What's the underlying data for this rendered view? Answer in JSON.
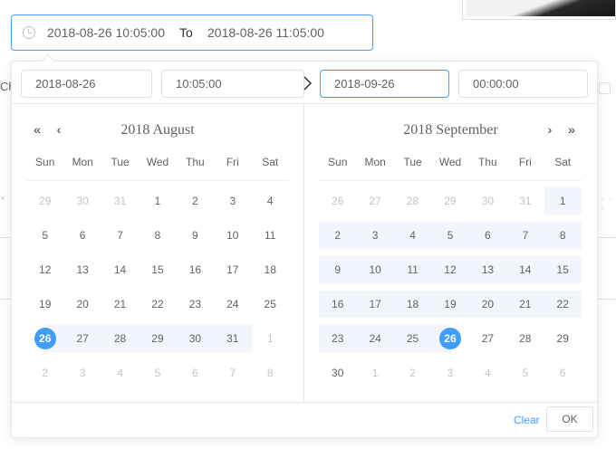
{
  "range": {
    "start": "2018-08-26 10:05:00",
    "separator": "To",
    "end": "2018-08-26 11:05:00"
  },
  "header": {
    "start_date": "2018-08-26",
    "start_time": "10:05:00",
    "end_date": "2018-09-26",
    "end_time": "00:00:00"
  },
  "background": {
    "partial_label": "Cha"
  },
  "left_calendar": {
    "title": "2018 August",
    "weekdays": [
      "Sun",
      "Mon",
      "Tue",
      "Wed",
      "Thu",
      "Fri",
      "Sat"
    ],
    "weeks": [
      [
        "29",
        "30",
        "31",
        "1",
        "2",
        "3",
        "4"
      ],
      [
        "5",
        "6",
        "7",
        "8",
        "9",
        "10",
        "11"
      ],
      [
        "12",
        "13",
        "14",
        "15",
        "16",
        "17",
        "18"
      ],
      [
        "19",
        "20",
        "21",
        "22",
        "23",
        "24",
        "25"
      ],
      [
        "26",
        "27",
        "28",
        "29",
        "30",
        "31",
        "1"
      ],
      [
        "2",
        "3",
        "4",
        "5",
        "6",
        "7",
        "8"
      ]
    ]
  },
  "right_calendar": {
    "title": "2018 September",
    "weekdays": [
      "Sun",
      "Mon",
      "Tue",
      "Wed",
      "Thu",
      "Fri",
      "Sat"
    ],
    "weeks": [
      [
        "26",
        "27",
        "28",
        "29",
        "30",
        "31",
        "1"
      ],
      [
        "2",
        "3",
        "4",
        "5",
        "6",
        "7",
        "8"
      ],
      [
        "9",
        "10",
        "11",
        "12",
        "13",
        "14",
        "15"
      ],
      [
        "16",
        "17",
        "18",
        "19",
        "20",
        "21",
        "22"
      ],
      [
        "23",
        "24",
        "25",
        "26",
        "27",
        "28",
        "29"
      ],
      [
        "30",
        "1",
        "2",
        "3",
        "4",
        "5",
        "6"
      ]
    ]
  },
  "footer": {
    "clear_label": "Clear",
    "ok_label": "OK"
  },
  "colors": {
    "accent": "#409eff",
    "range_background": "#f2f6fc"
  },
  "icons": {
    "range_icon": "clock-icon",
    "prev_year": "double-chevron-left-icon",
    "prev_month": "chevron-left-icon",
    "next_month": "chevron-right-icon",
    "next_year": "double-chevron-right-icon",
    "range_arrow": "arrow-right-icon"
  }
}
